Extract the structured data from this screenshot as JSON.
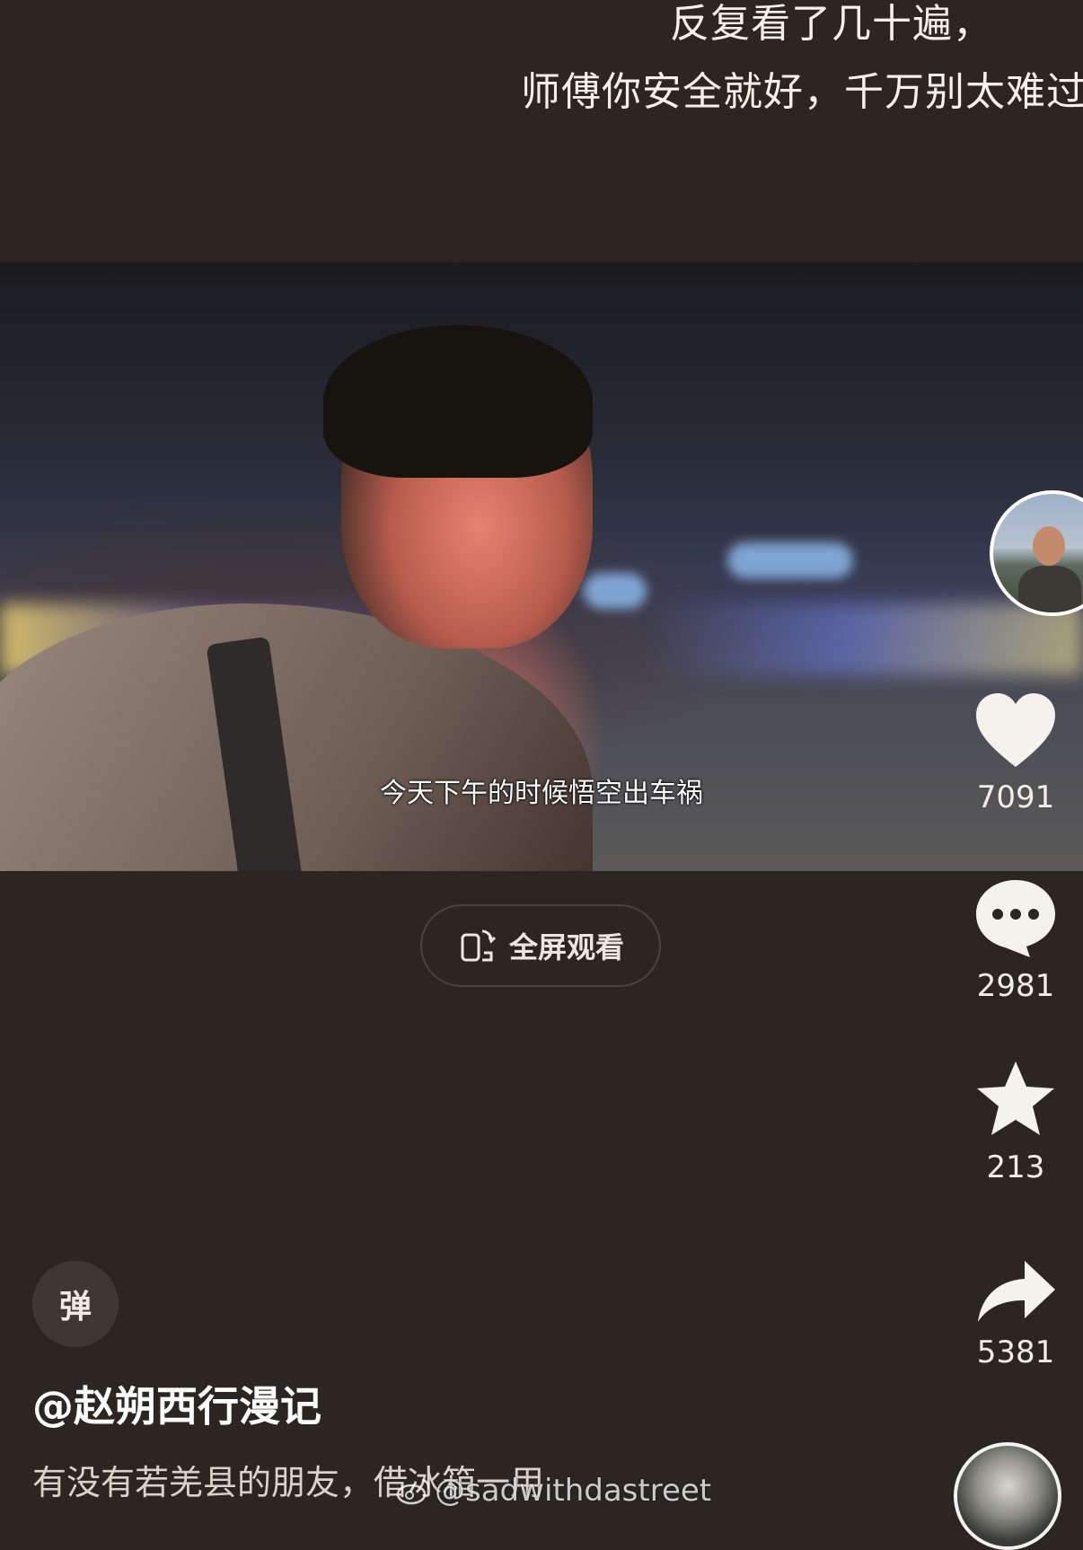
{
  "overlay_text": {
    "line1": "反复看了几十遍，",
    "line2": "师傅你安全就好，千万别太难过"
  },
  "video": {
    "subtitle": "今天下午的时候悟空出车祸"
  },
  "fullscreen_button": {
    "label": "全屏观看",
    "icon": "rotate-phone-icon"
  },
  "actions": {
    "likes": "7091",
    "comments": "2981",
    "favorites": "213",
    "shares": "5381"
  },
  "danmu_button": {
    "label": "弹"
  },
  "post": {
    "author": "@赵朔西行漫记",
    "description": "有没有若羌县的朋友，借冰箱一用"
  },
  "watermark": {
    "text": "@sadwithdastreet",
    "icon": "weibo-icon"
  },
  "colors": {
    "background": "#2b2621",
    "text": "#ffffff"
  }
}
